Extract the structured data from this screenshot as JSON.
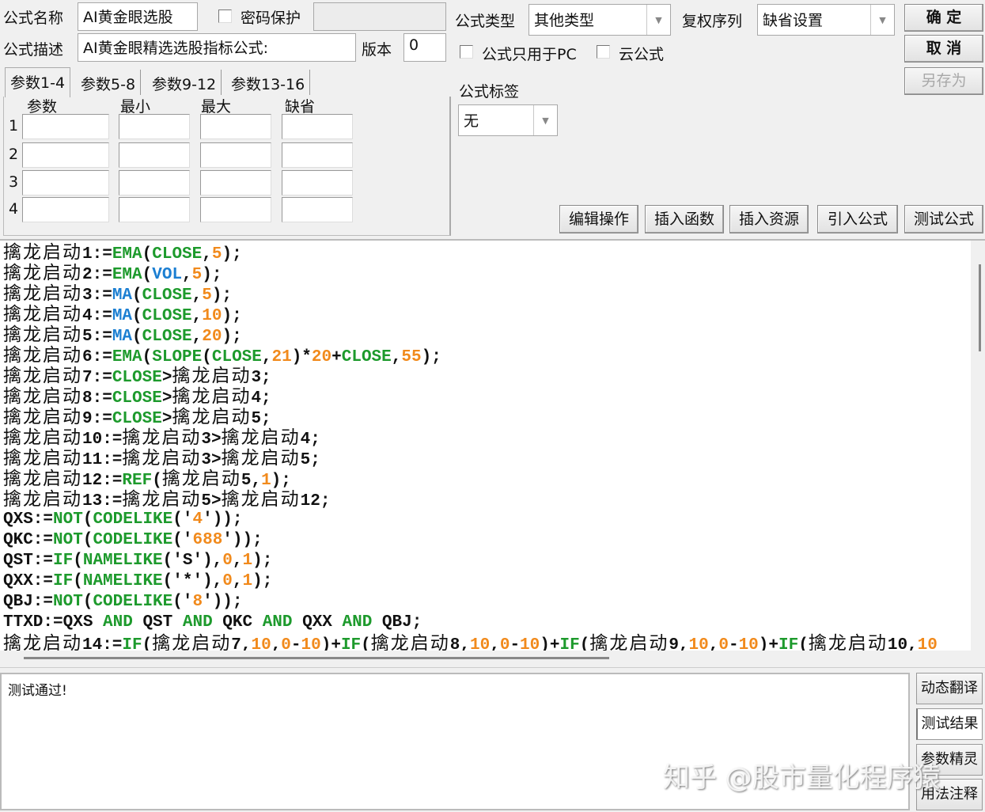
{
  "form": {
    "name_label": "公式名称",
    "name_value": "AI黄金眼选股",
    "password_label": "密码保护",
    "password_value": "",
    "desc_label": "公式描述",
    "desc_value": "AI黄金眼精选选股指标公式:",
    "version_label": "版本",
    "version_value": "0",
    "type_label": "公式类型",
    "type_value": "其他类型",
    "rights_label": "复权序列",
    "rights_value": "缺省设置",
    "pc_only_label": "公式只用于PC",
    "cloud_label": "云公式",
    "tag_label": "公式标签",
    "tag_value": "无"
  },
  "buttons": {
    "ok": "确 定",
    "cancel": "取 消",
    "save_as": "另存为"
  },
  "tabs": [
    "参数1-4",
    "参数5-8",
    "参数9-12",
    "参数13-16"
  ],
  "params": {
    "headers": [
      "参数",
      "最小",
      "最大",
      "缺省"
    ],
    "rows": [
      "1",
      "2",
      "3",
      "4"
    ]
  },
  "toolbar": [
    "编辑操作",
    "插入函数",
    "插入资源",
    "引入公式",
    "测试公式"
  ],
  "code": [
    [
      [
        "擒龙启动",
        "z"
      ],
      [
        "1:=",
        "k"
      ],
      [
        "EMA",
        "g"
      ],
      [
        "(",
        "k"
      ],
      [
        "CLOSE",
        "g"
      ],
      [
        ",",
        "k"
      ],
      [
        "5",
        "o"
      ],
      [
        ");",
        "k"
      ]
    ],
    [
      [
        "擒龙启动",
        "z"
      ],
      [
        "2:=",
        "k"
      ],
      [
        "EMA",
        "g"
      ],
      [
        "(",
        "k"
      ],
      [
        "VOL",
        "b"
      ],
      [
        ",",
        "k"
      ],
      [
        "5",
        "o"
      ],
      [
        ");",
        "k"
      ]
    ],
    [
      [
        "擒龙启动",
        "z"
      ],
      [
        "3:=",
        "k"
      ],
      [
        "MA",
        "b"
      ],
      [
        "(",
        "k"
      ],
      [
        "CLOSE",
        "g"
      ],
      [
        ",",
        "k"
      ],
      [
        "5",
        "o"
      ],
      [
        ");",
        "k"
      ]
    ],
    [
      [
        "擒龙启动",
        "z"
      ],
      [
        "4:=",
        "k"
      ],
      [
        "MA",
        "b"
      ],
      [
        "(",
        "k"
      ],
      [
        "CLOSE",
        "g"
      ],
      [
        ",",
        "k"
      ],
      [
        "10",
        "o"
      ],
      [
        ");",
        "k"
      ]
    ],
    [
      [
        "擒龙启动",
        "z"
      ],
      [
        "5:=",
        "k"
      ],
      [
        "MA",
        "b"
      ],
      [
        "(",
        "k"
      ],
      [
        "CLOSE",
        "g"
      ],
      [
        ",",
        "k"
      ],
      [
        "20",
        "o"
      ],
      [
        ");",
        "k"
      ]
    ],
    [
      [
        "擒龙启动",
        "z"
      ],
      [
        "6:=",
        "k"
      ],
      [
        "EMA",
        "g"
      ],
      [
        "(",
        "k"
      ],
      [
        "SLOPE",
        "g"
      ],
      [
        "(",
        "k"
      ],
      [
        "CLOSE",
        "g"
      ],
      [
        ",",
        "k"
      ],
      [
        "21",
        "o"
      ],
      [
        ")*",
        "k"
      ],
      [
        "20",
        "o"
      ],
      [
        "+",
        "k"
      ],
      [
        "CLOSE",
        "g"
      ],
      [
        ",",
        "k"
      ],
      [
        "55",
        "o"
      ],
      [
        ");",
        "k"
      ]
    ],
    [
      [
        "擒龙启动",
        "z"
      ],
      [
        "7:=",
        "k"
      ],
      [
        "CLOSE",
        "g"
      ],
      [
        ">",
        "k"
      ],
      [
        "擒龙启动",
        "z"
      ],
      [
        "3;",
        "k"
      ]
    ],
    [
      [
        "擒龙启动",
        "z"
      ],
      [
        "8:=",
        "k"
      ],
      [
        "CLOSE",
        "g"
      ],
      [
        ">",
        "k"
      ],
      [
        "擒龙启动",
        "z"
      ],
      [
        "4;",
        "k"
      ]
    ],
    [
      [
        "擒龙启动",
        "z"
      ],
      [
        "9:=",
        "k"
      ],
      [
        "CLOSE",
        "g"
      ],
      [
        ">",
        "k"
      ],
      [
        "擒龙启动",
        "z"
      ],
      [
        "5;",
        "k"
      ]
    ],
    [
      [
        "擒龙启动",
        "z"
      ],
      [
        "10:=",
        "k"
      ],
      [
        "擒龙启动",
        "z"
      ],
      [
        "3>",
        "k"
      ],
      [
        "擒龙启动",
        "z"
      ],
      [
        "4;",
        "k"
      ]
    ],
    [
      [
        "擒龙启动",
        "z"
      ],
      [
        "11:=",
        "k"
      ],
      [
        "擒龙启动",
        "z"
      ],
      [
        "3>",
        "k"
      ],
      [
        "擒龙启动",
        "z"
      ],
      [
        "5;",
        "k"
      ]
    ],
    [
      [
        "擒龙启动",
        "z"
      ],
      [
        "12:=",
        "k"
      ],
      [
        "REF",
        "g"
      ],
      [
        "(",
        "k"
      ],
      [
        "擒龙启动",
        "z"
      ],
      [
        "5,",
        "k"
      ],
      [
        "1",
        "o"
      ],
      [
        ");",
        "k"
      ]
    ],
    [
      [
        "擒龙启动",
        "z"
      ],
      [
        "13:=",
        "k"
      ],
      [
        "擒龙启动",
        "z"
      ],
      [
        "5>",
        "k"
      ],
      [
        "擒龙启动",
        "z"
      ],
      [
        "12;",
        "k"
      ]
    ],
    [
      [
        "QXS:=",
        "k"
      ],
      [
        "NOT",
        "g"
      ],
      [
        "(",
        "k"
      ],
      [
        "CODELIKE",
        "g"
      ],
      [
        "('",
        "k"
      ],
      [
        "4",
        "o"
      ],
      [
        "'));",
        "k"
      ]
    ],
    [
      [
        "QKC:=",
        "k"
      ],
      [
        "NOT",
        "g"
      ],
      [
        "(",
        "k"
      ],
      [
        "CODELIKE",
        "g"
      ],
      [
        "('",
        "k"
      ],
      [
        "688",
        "o"
      ],
      [
        "'));",
        "k"
      ]
    ],
    [
      [
        "QST:=",
        "k"
      ],
      [
        "IF",
        "g"
      ],
      [
        "(",
        "k"
      ],
      [
        "NAMELIKE",
        "g"
      ],
      [
        "('S'),",
        "k"
      ],
      [
        "0",
        "o"
      ],
      [
        ",",
        "k"
      ],
      [
        "1",
        "o"
      ],
      [
        ");",
        "k"
      ]
    ],
    [
      [
        "QXX:=",
        "k"
      ],
      [
        "IF",
        "g"
      ],
      [
        "(",
        "k"
      ],
      [
        "NAMELIKE",
        "g"
      ],
      [
        "('*'),",
        "k"
      ],
      [
        "0",
        "o"
      ],
      [
        ",",
        "k"
      ],
      [
        "1",
        "o"
      ],
      [
        ");",
        "k"
      ]
    ],
    [
      [
        "QBJ:=",
        "k"
      ],
      [
        "NOT",
        "g"
      ],
      [
        "(",
        "k"
      ],
      [
        "CODELIKE",
        "g"
      ],
      [
        "('",
        "k"
      ],
      [
        "8",
        "o"
      ],
      [
        "'));",
        "k"
      ]
    ],
    [
      [
        "TTXD:=QXS ",
        "k"
      ],
      [
        "AND",
        "g"
      ],
      [
        " QST ",
        "k"
      ],
      [
        "AND",
        "g"
      ],
      [
        " QKC ",
        "k"
      ],
      [
        "AND",
        "g"
      ],
      [
        " QXX ",
        "k"
      ],
      [
        "AND",
        "g"
      ],
      [
        " QBJ;",
        "k"
      ]
    ],
    [
      [
        "擒龙启动",
        "z"
      ],
      [
        "14:=",
        "k"
      ],
      [
        "IF",
        "g"
      ],
      [
        "(",
        "k"
      ],
      [
        "擒龙启动",
        "z"
      ],
      [
        "7,",
        "k"
      ],
      [
        "10",
        "o"
      ],
      [
        ",",
        "k"
      ],
      [
        "0",
        "o"
      ],
      [
        "-",
        "k"
      ],
      [
        "10",
        "o"
      ],
      [
        ")+",
        "k"
      ],
      [
        "IF",
        "g"
      ],
      [
        "(",
        "k"
      ],
      [
        "擒龙启动",
        "z"
      ],
      [
        "8,",
        "k"
      ],
      [
        "10",
        "o"
      ],
      [
        ",",
        "k"
      ],
      [
        "0",
        "o"
      ],
      [
        "-",
        "k"
      ],
      [
        "10",
        "o"
      ],
      [
        ")+",
        "k"
      ],
      [
        "IF",
        "g"
      ],
      [
        "(",
        "k"
      ],
      [
        "擒龙启动",
        "z"
      ],
      [
        "9,",
        "k"
      ],
      [
        "10",
        "o"
      ],
      [
        ",",
        "k"
      ],
      [
        "0",
        "o"
      ],
      [
        "-",
        "k"
      ],
      [
        "10",
        "o"
      ],
      [
        ")+",
        "k"
      ],
      [
        "IF",
        "g"
      ],
      [
        "(",
        "k"
      ],
      [
        "擒龙启动",
        "z"
      ],
      [
        "10,",
        "k"
      ],
      [
        "10",
        "o"
      ]
    ]
  ],
  "output": {
    "text": "测试通过!"
  },
  "side_buttons": [
    "动态翻译",
    "测试结果",
    "参数精灵",
    "用法注释"
  ],
  "watermark": "知乎 @股市量化程序猿",
  "colors": {
    "keyword_green": "#1d9a2c",
    "keyword_blue": "#1c7fd2",
    "number_orange": "#f18a1c"
  }
}
